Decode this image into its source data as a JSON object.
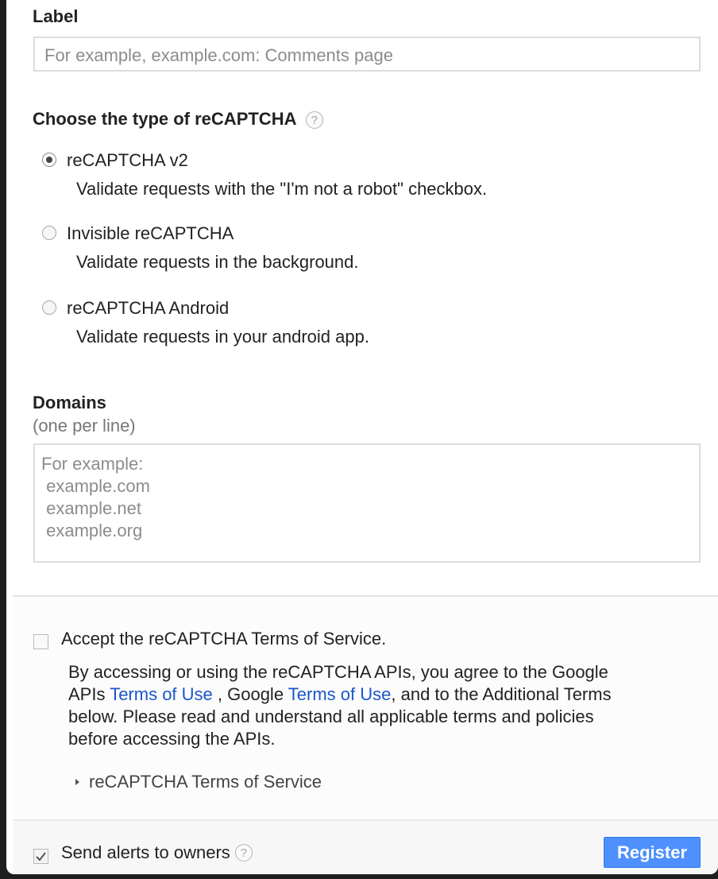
{
  "label_section": {
    "heading": "Label",
    "placeholder": "For example, example.com: Comments page"
  },
  "type_section": {
    "heading": "Choose the type of reCAPTCHA",
    "help_glyph": "?",
    "options": [
      {
        "title": "reCAPTCHA v2",
        "desc": "Validate requests with the \"I'm not a robot\" checkbox.",
        "selected": true
      },
      {
        "title": "Invisible reCAPTCHA",
        "desc": "Validate requests in the background.",
        "selected": false
      },
      {
        "title": "reCAPTCHA Android",
        "desc": "Validate requests in your android app.",
        "selected": false
      }
    ]
  },
  "domains_section": {
    "heading": "Domains",
    "subheading": "(one per line)",
    "placeholder_lines": [
      "For example:",
      " example.com",
      " example.net",
      " example.org"
    ]
  },
  "terms_section": {
    "accept_label": "Accept the reCAPTCHA Terms of Service.",
    "text_1": "By accessing or using the reCAPTCHA APIs, you agree to the Google",
    "text_2a": "APIs ",
    "link_1": "Terms of Use",
    "text_2b": " , Google ",
    "link_2": "Terms of Use",
    "text_2c": ", and to the Additional Terms",
    "text_3": "below. Please read and understand all applicable terms and policies",
    "text_4": "before accessing the APIs.",
    "expander_label": "reCAPTCHA Terms of Service",
    "accepted": false
  },
  "footer": {
    "alerts_label": "Send alerts to owners",
    "alerts_checked": true,
    "help_glyph": "?",
    "register_label": "Register"
  },
  "colors": {
    "accent": "#4d90fe",
    "link": "#1a56c8"
  }
}
